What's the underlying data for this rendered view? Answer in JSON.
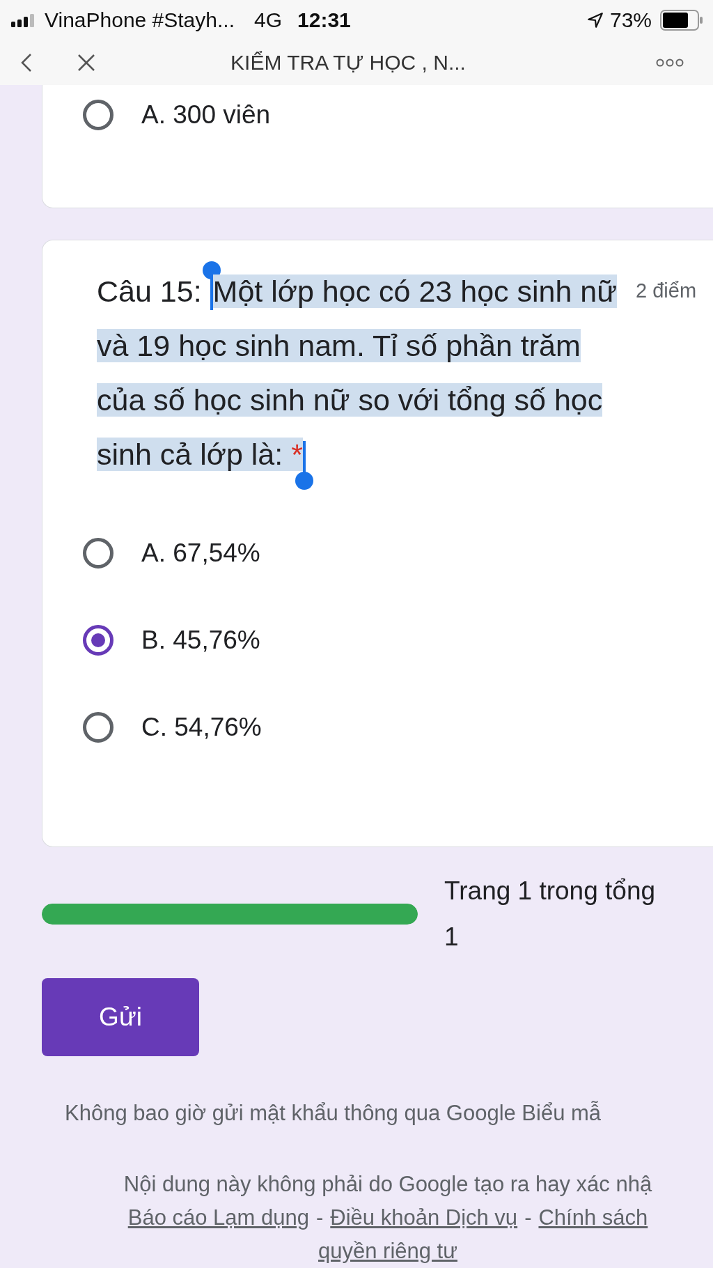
{
  "status_bar": {
    "carrier": "VinaPhone #Stayh...",
    "network": "4G",
    "time": "12:31",
    "battery": "73%"
  },
  "nav": {
    "title": "KIỂM TRA TỰ HỌC , N..."
  },
  "previous_question": {
    "options": [
      {
        "label": "A. 300 viên",
        "selected": false
      }
    ]
  },
  "question": {
    "prefix": "Câu 15:",
    "text": "Một lớp học có 23 học sinh nữ và 19 học sinh nam. Tỉ số phần trăm của số học sinh nữ so với tổng số học sinh cả lớp là:",
    "required_mark": "*",
    "text_selected": true,
    "points": "2 điểm",
    "options": [
      {
        "label": "A. 67,54%",
        "selected": false
      },
      {
        "label": "B. 45,76%",
        "selected": true
      },
      {
        "label": "C. 54,76%",
        "selected": false
      }
    ]
  },
  "progress": {
    "level": 1,
    "text": "Trang 1 trong tổng",
    "text_line2": "1"
  },
  "submit": "Gửi",
  "footer": {
    "notice": "Không bao giờ gửi mật khẩu thông qua Google Biểu mẫ",
    "disclaimer": "Nội dung này không phải do Google tạo ra hay xác nhậ",
    "links": [
      {
        "kind": "link",
        "text": "Báo cáo Lạm dụng"
      },
      {
        "kind": "separator",
        "text": "-"
      },
      {
        "kind": "link",
        "text": "Điều khoản Dịch vụ"
      },
      {
        "kind": "separator",
        "text": "-"
      },
      {
        "kind": "link",
        "text": "Chính sách"
      }
    ],
    "last_link": "quyền riêng tư"
  }
}
